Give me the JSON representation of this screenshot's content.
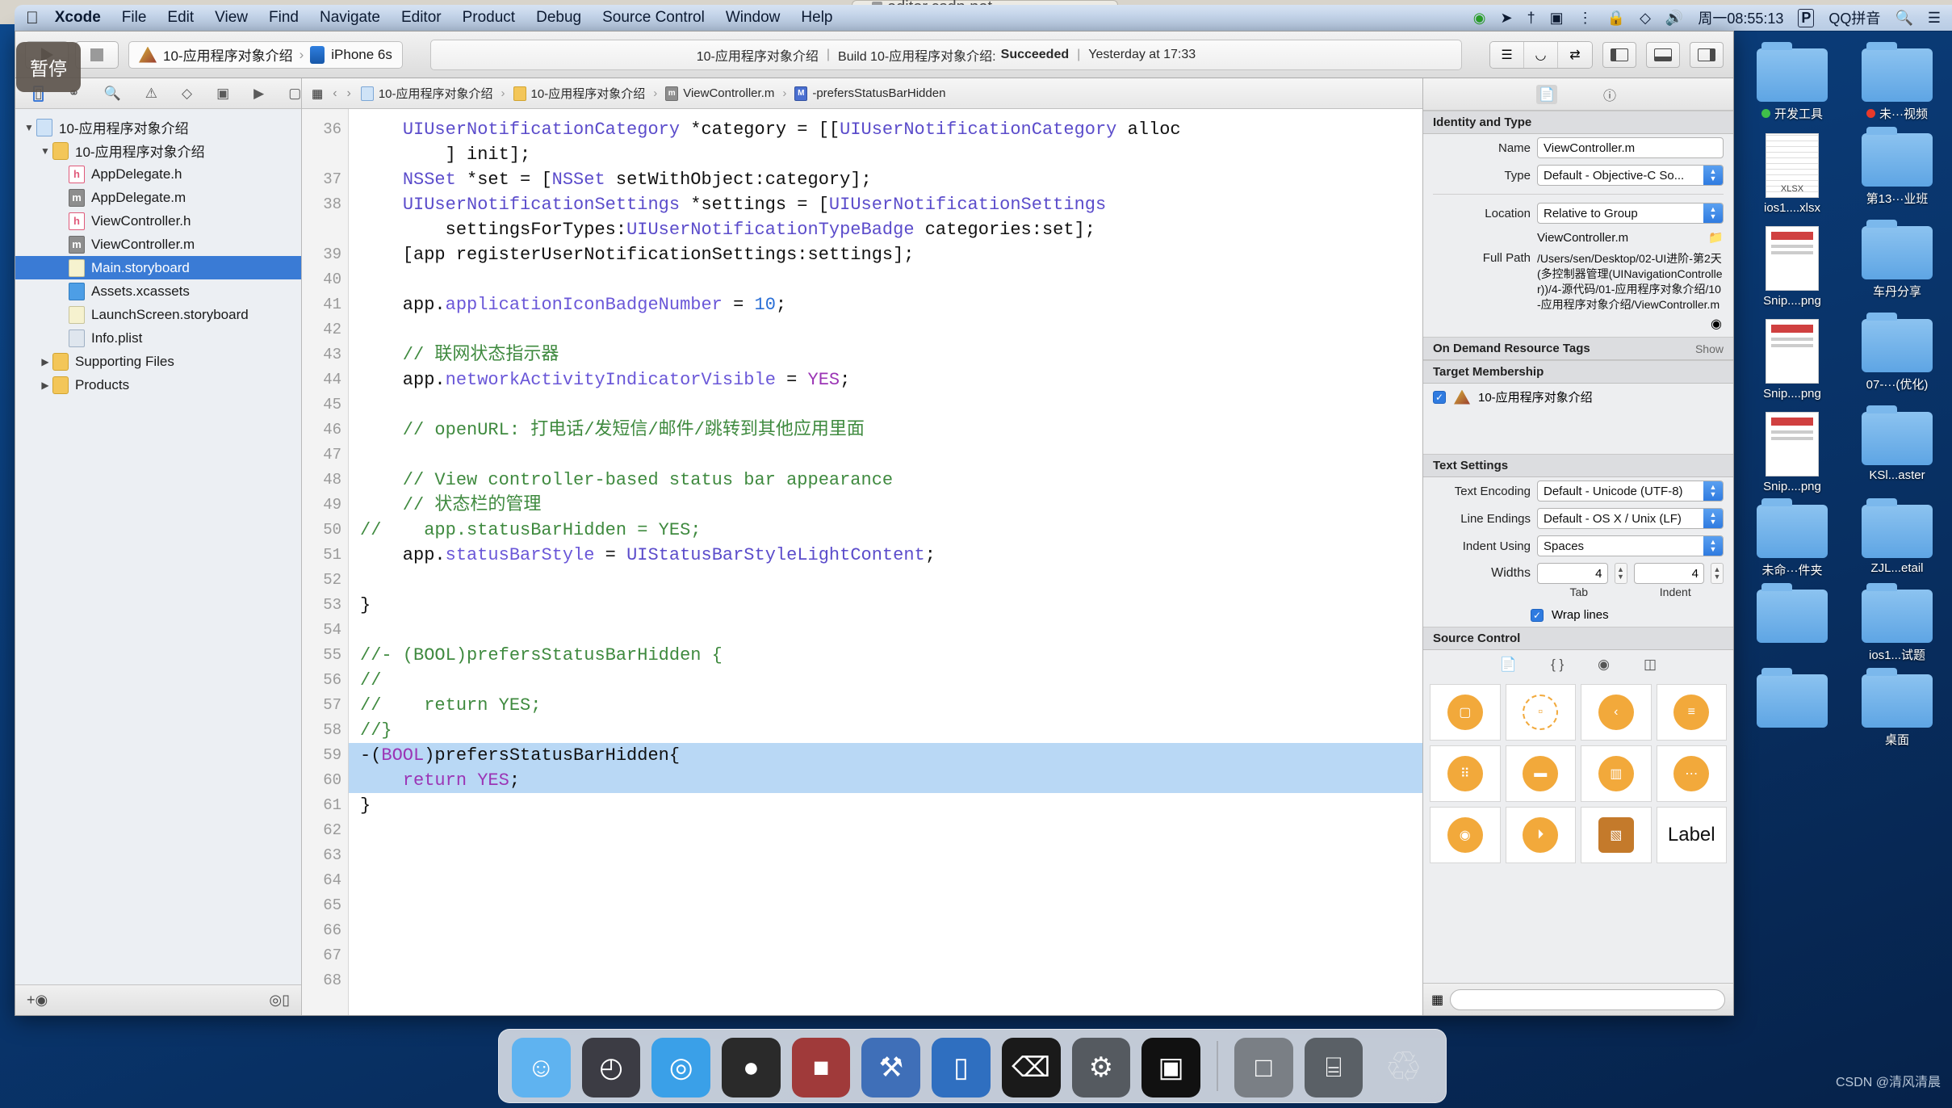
{
  "desktop": {
    "browser_url": "editor.csdn.net",
    "watermark": "CSDN @清风清晨",
    "pause_badge": "暂停",
    "icons": [
      {
        "label": "开发工具",
        "type": "folder",
        "dot": "#3fbf4a"
      },
      {
        "label": "未···视频",
        "type": "folder",
        "dot": "#e8392a"
      },
      {
        "label": "ios1....xlsx",
        "type": "xlsx",
        "dot": ""
      },
      {
        "label": "第13···业班",
        "type": "folder",
        "dot": ""
      },
      {
        "label": "Snip....png",
        "type": "png",
        "dot": ""
      },
      {
        "label": "车丹分享",
        "type": "folder",
        "dot": ""
      },
      {
        "label": "Snip....png",
        "type": "png",
        "dot": ""
      },
      {
        "label": "07-···(优化)",
        "type": "folder",
        "dot": ""
      },
      {
        "label": "Snip....png",
        "type": "png",
        "dot": ""
      },
      {
        "label": "KSl...aster",
        "type": "folder",
        "dot": ""
      },
      {
        "label": "未命···件夹",
        "type": "folder",
        "dot": ""
      },
      {
        "label": "ZJL...etail",
        "type": "folder",
        "dot": ""
      },
      {
        "label": "",
        "type": "folder",
        "dot": ""
      },
      {
        "label": "ios1...试题",
        "type": "folder",
        "dot": ""
      },
      {
        "label": "",
        "type": "folder",
        "dot": ""
      },
      {
        "label": "桌面",
        "type": "folder",
        "dot": ""
      }
    ]
  },
  "menubar": {
    "apple": "",
    "items": [
      "Xcode",
      "File",
      "Edit",
      "View",
      "Find",
      "Navigate",
      "Editor",
      "Product",
      "Debug",
      "Source Control",
      "Window",
      "Help"
    ],
    "status_right": {
      "clock": "周一08:55:13",
      "input_method": "QQ拼音",
      "pinyin_badge": "P",
      "search_icon": "search-icon",
      "list_icon": "control-center-icon"
    }
  },
  "toolbar": {
    "run_label": "run-button",
    "stop_label": "stop-button",
    "scheme": "10-应用程序对象介绍",
    "destination": "iPhone 6s",
    "status_project": "10-应用程序对象介绍",
    "status_separator": "|",
    "status_build": "Build 10-应用程序对象介绍:",
    "status_result": "Succeeded",
    "status_time": "Yesterday at 17:33"
  },
  "navigator": {
    "tabs": [
      "project-navigator",
      "symbol-navigator",
      "find-navigator",
      "issue-navigator",
      "test-navigator",
      "debug-navigator"
    ],
    "tree": [
      {
        "label": "10-应用程序对象介绍",
        "indent": 0,
        "icon": "proj",
        "twisty": "▼",
        "selected": false
      },
      {
        "label": "10-应用程序对象介绍",
        "indent": 1,
        "icon": "folder",
        "twisty": "▼",
        "selected": false
      },
      {
        "label": "AppDelegate.h",
        "indent": 2,
        "icon": "h",
        "twisty": "",
        "selected": false
      },
      {
        "label": "AppDelegate.m",
        "indent": 2,
        "icon": "m",
        "twisty": "",
        "selected": false
      },
      {
        "label": "ViewController.h",
        "indent": 2,
        "icon": "h",
        "twisty": "",
        "selected": false
      },
      {
        "label": "ViewController.m",
        "indent": 2,
        "icon": "m",
        "twisty": "",
        "selected": false
      },
      {
        "label": "Main.storyboard",
        "indent": 2,
        "icon": "story",
        "twisty": "",
        "selected": true
      },
      {
        "label": "Assets.xcassets",
        "indent": 2,
        "icon": "assets",
        "twisty": "",
        "selected": false
      },
      {
        "label": "LaunchScreen.storyboard",
        "indent": 2,
        "icon": "story",
        "twisty": "",
        "selected": false
      },
      {
        "label": "Info.plist",
        "indent": 2,
        "icon": "plist",
        "twisty": "",
        "selected": false
      },
      {
        "label": "Supporting Files",
        "indent": 1,
        "icon": "folder",
        "twisty": "▶",
        "selected": false
      },
      {
        "label": "Products",
        "indent": 1,
        "icon": "folder",
        "twisty": "▶",
        "selected": false
      }
    ],
    "bottom": {
      "add": "+",
      "filter": "filter-icon"
    }
  },
  "editor": {
    "breadcrumb": [
      {
        "label": "10-应用程序对象介绍",
        "icon": "proj"
      },
      {
        "label": "10-应用程序对象介绍",
        "icon": "folder"
      },
      {
        "label": "ViewController.m",
        "icon": "m"
      },
      {
        "label": "-prefersStatusBarHidden",
        "icon": "blue"
      }
    ],
    "first_line_number": 36,
    "lines": [
      {
        "n": "36",
        "text": "    UIUserNotificationCategory *category = [[UIUserNotificationCategory alloc",
        "hl": false
      },
      {
        "n": "",
        "text": "        ] init];",
        "hl": false
      },
      {
        "n": "37",
        "text": "    NSSet *set = [NSSet setWithObject:category];",
        "hl": false
      },
      {
        "n": "38",
        "text": "    UIUserNotificationSettings *settings = [UIUserNotificationSettings",
        "hl": false
      },
      {
        "n": "",
        "text": "        settingsForTypes:UIUserNotificationTypeBadge categories:set];",
        "hl": false
      },
      {
        "n": "39",
        "text": "    [app registerUserNotificationSettings:settings];",
        "hl": false
      },
      {
        "n": "40",
        "text": "",
        "hl": false
      },
      {
        "n": "41",
        "text": "    app.applicationIconBadgeNumber = 10;",
        "hl": false
      },
      {
        "n": "42",
        "text": "",
        "hl": false
      },
      {
        "n": "43",
        "text": "    // 联网状态指示器",
        "hl": false
      },
      {
        "n": "44",
        "text": "    app.networkActivityIndicatorVisible = YES;",
        "hl": false
      },
      {
        "n": "45",
        "text": "",
        "hl": false
      },
      {
        "n": "46",
        "text": "    // openURL: 打电话/发短信/邮件/跳转到其他应用里面",
        "hl": false
      },
      {
        "n": "47",
        "text": "",
        "hl": false
      },
      {
        "n": "48",
        "text": "    // View controller-based status bar appearance",
        "hl": false
      },
      {
        "n": "49",
        "text": "    // 状态栏的管理",
        "hl": false
      },
      {
        "n": "50",
        "text": "//    app.statusBarHidden = YES;",
        "hl": false
      },
      {
        "n": "51",
        "text": "    app.statusBarStyle = UIStatusBarStyleLightContent;",
        "hl": false
      },
      {
        "n": "52",
        "text": "",
        "hl": false
      },
      {
        "n": "53",
        "text": "}",
        "hl": false
      },
      {
        "n": "54",
        "text": "",
        "hl": false
      },
      {
        "n": "55",
        "text": "//- (BOOL)prefersStatusBarHidden {",
        "hl": false
      },
      {
        "n": "56",
        "text": "//",
        "hl": false
      },
      {
        "n": "57",
        "text": "//    return YES;",
        "hl": false
      },
      {
        "n": "58",
        "text": "//}",
        "hl": false
      },
      {
        "n": "59",
        "text": "-(BOOL)prefersStatusBarHidden{",
        "hl": true
      },
      {
        "n": "60",
        "text": "    return YES;",
        "hl": true
      },
      {
        "n": "61",
        "text": "}",
        "hl": false
      },
      {
        "n": "62",
        "text": "",
        "hl": false
      },
      {
        "n": "63",
        "text": "",
        "hl": false
      },
      {
        "n": "64",
        "text": "",
        "hl": false
      },
      {
        "n": "65",
        "text": "",
        "hl": false
      },
      {
        "n": "66",
        "text": "",
        "hl": false
      },
      {
        "n": "67",
        "text": "",
        "hl": false
      },
      {
        "n": "68",
        "text": "",
        "hl": false
      }
    ]
  },
  "inspector": {
    "tabs": [
      "file-inspector",
      "quick-help-inspector"
    ],
    "identity": {
      "title": "Identity and Type",
      "name_label": "Name",
      "name_value": "ViewController.m",
      "type_label": "Type",
      "type_value": "Default - Objective-C So...",
      "location_label": "Location",
      "location_value": "Relative to Group",
      "location_file": "ViewController.m",
      "fullpath_label": "Full Path",
      "fullpath_value": "/Users/sen/Desktop/02-UI进阶-第2天(多控制器管理(UINavigationController))/4-源代码/01-应用程序对象介绍/10-应用程序对象介绍/ViewController.m"
    },
    "ondemand": {
      "title": "On Demand Resource Tags",
      "show": "Show"
    },
    "target_membership": {
      "title": "Target Membership",
      "item": "10-应用程序对象介绍",
      "checked": true
    },
    "text_settings": {
      "title": "Text Settings",
      "encoding_label": "Text Encoding",
      "encoding_value": "Default - Unicode (UTF-8)",
      "endings_label": "Line Endings",
      "endings_value": "Default - OS X / Unix (LF)",
      "indent_label": "Indent Using",
      "indent_value": "Spaces",
      "widths_label": "Widths",
      "tab_value": "4",
      "indent_width_value": "4",
      "tab_caption": "Tab",
      "indent_caption": "Indent",
      "wrap_label": "Wrap lines",
      "wrap_checked": true
    },
    "source_control": {
      "title": "Source Control"
    },
    "library": {
      "items": [
        "view-controller-icon",
        "view-controller-dashed-icon",
        "navigation-controller-icon",
        "table-view-controller-icon",
        "collection-view-controller-icon",
        "tab-bar-controller-icon",
        "split-view-controller-icon",
        "page-view-controller-icon",
        "glkit-view-controller-icon",
        "avkit-player-icon",
        "object-icon",
        "label-item"
      ],
      "label_item_text": "Label"
    }
  },
  "dock": {
    "items": [
      "finder-icon",
      "launchpad-icon",
      "safari-icon",
      "shadowsocks-icon",
      "quicktime-icon",
      "xcode-icon",
      "simulator-icon",
      "terminal-icon",
      "system-prefs-icon",
      "executable-icon",
      "screen-icon",
      "calculator-icon",
      "trash-icon"
    ]
  }
}
